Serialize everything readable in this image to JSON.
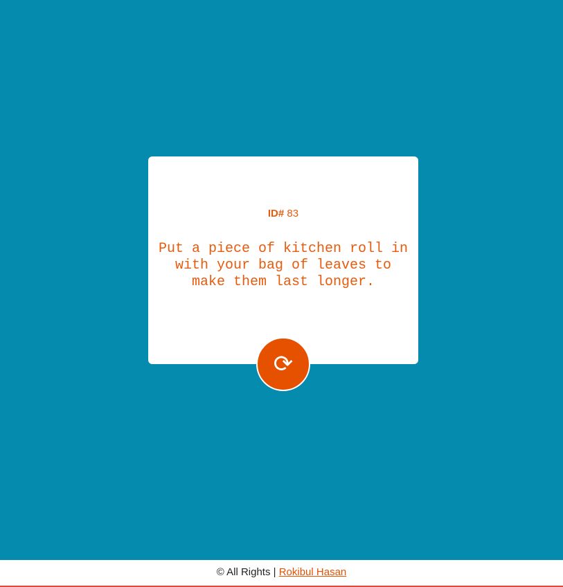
{
  "card": {
    "id_label": "ID#",
    "id_value": "83",
    "advice": "Put a piece of kitchen roll in with your bag of leaves to make them last longer."
  },
  "refresh_button": {
    "icon": "refresh-icon",
    "glyph": "⟳"
  },
  "footer": {
    "rights_text": "© All Rights |",
    "author_link": "Rokibul Hasan"
  },
  "colors": {
    "background": "#058bad",
    "accent": "#e65100",
    "card": "#ffffff"
  }
}
